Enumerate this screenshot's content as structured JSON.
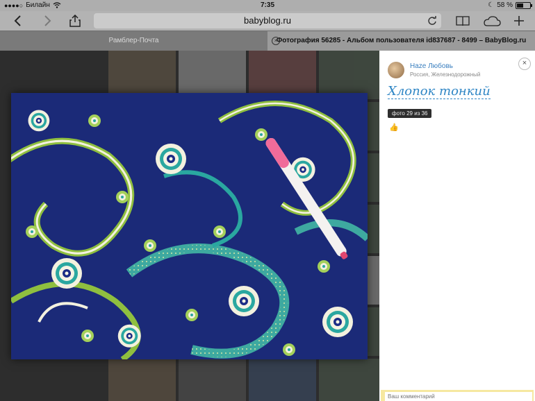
{
  "status_bar": {
    "carrier": "Билайн",
    "time": "7:35",
    "battery_percent": "58 %",
    "battery_level": 0.58
  },
  "toolbar": {
    "url": "babyblog.ru",
    "icons": [
      "back-icon",
      "forward-icon",
      "share-icon",
      "reload-icon",
      "bookmarks-icon",
      "cloud-tabs-icon",
      "new-tab-icon"
    ]
  },
  "tabs": [
    {
      "label": "Рамблер-Почта",
      "active": false
    },
    {
      "label": "Фотография 56285 - Альбом пользователя id837687 - 8499 – BabyBlog.ru",
      "active": true
    }
  ],
  "photo_panel": {
    "user_name": "Haze Любовь",
    "user_location": "Россия, Железнодорожный",
    "photo_title": "Хлопок тонкий",
    "photo_counter": "фото 29 из 36",
    "close_label": "×",
    "comment_placeholder": "Ваш комментарий"
  },
  "colors": {
    "link_blue": "#2f86c5",
    "paisley_navy": "#1b2a78",
    "paisley_green": "#8fbf3f",
    "paisley_teal": "#3ea9a0",
    "marker_pink": "#f06b9a"
  }
}
